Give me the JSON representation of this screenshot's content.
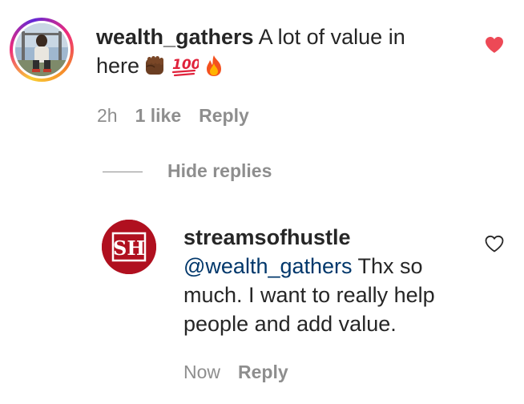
{
  "comment": {
    "username": "wealth_gathers",
    "text": "A lot of value in",
    "text_line2": "here",
    "emoji_hundred": "100",
    "time": "2h",
    "likes": "1 like",
    "reply_label": "Reply",
    "liked": true
  },
  "thread": {
    "hide_replies_label": "Hide replies"
  },
  "reply": {
    "username": "streamsofhustle",
    "avatar_monogram": "SH",
    "mention": "@wealth_gathers",
    "text_line1": " Thx so",
    "text_line2": "much. I want to really help",
    "text_line3": "people and add value.",
    "time": "Now",
    "reply_label": "Reply",
    "liked": false
  },
  "colors": {
    "heart_filled": "#ed4956",
    "mention": "#00376b",
    "secondary_text": "#8e8e8e",
    "brand_red": "#b0101f"
  }
}
